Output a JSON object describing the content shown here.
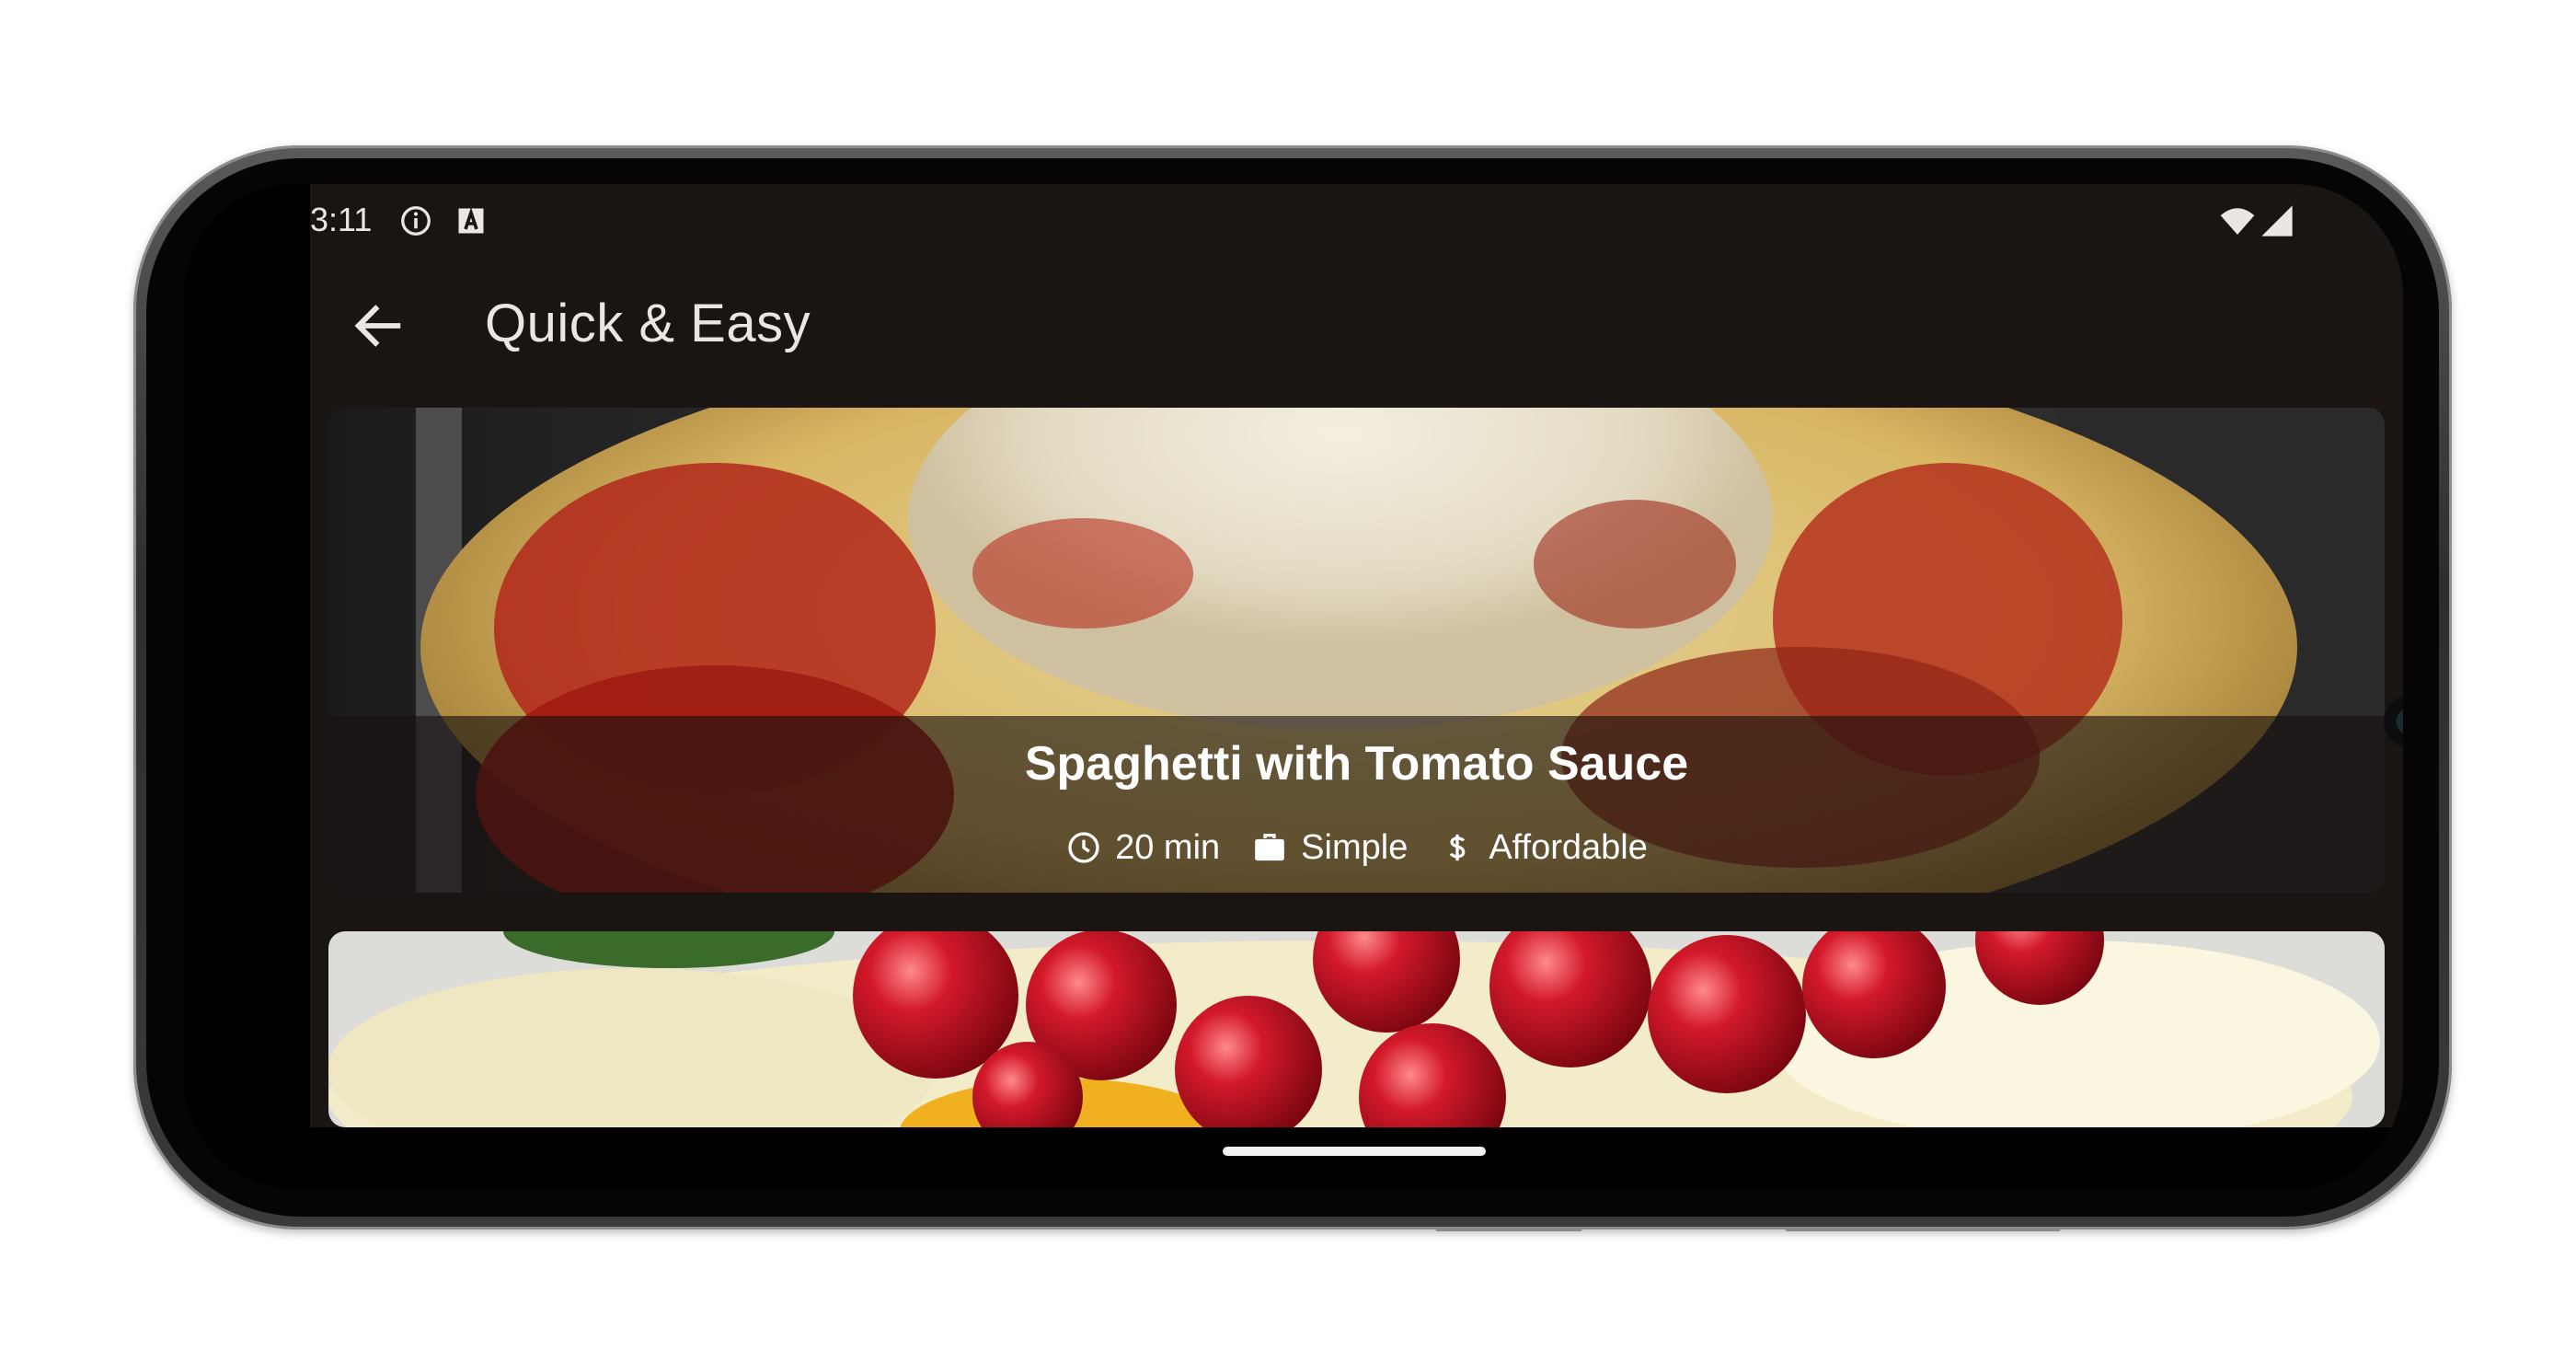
{
  "status_bar": {
    "time": "3:11",
    "icons_left": [
      "info-circle-icon",
      "font-a-icon"
    ],
    "icons_right": [
      "wifi-icon",
      "cell-signal-icon"
    ]
  },
  "app_bar": {
    "back_icon": "arrow-left-icon",
    "title": "Quick & Easy"
  },
  "meals": [
    {
      "title": "Spaghetti with Tomato Sauce",
      "image": "spaghetti-photo",
      "duration": "20 min",
      "complexity": "Simple",
      "affordability": "Affordable",
      "duration_icon": "clock-icon",
      "complexity_icon": "briefcase-icon",
      "affordability_icon": "dollar-icon"
    },
    {
      "title": "",
      "image": "red-currants-dessert-photo"
    }
  ],
  "colors": {
    "app_background": "#1a1412",
    "on_surface": "#ece6e2",
    "overlay": "#16100e",
    "accent_text": "#ffffff"
  }
}
